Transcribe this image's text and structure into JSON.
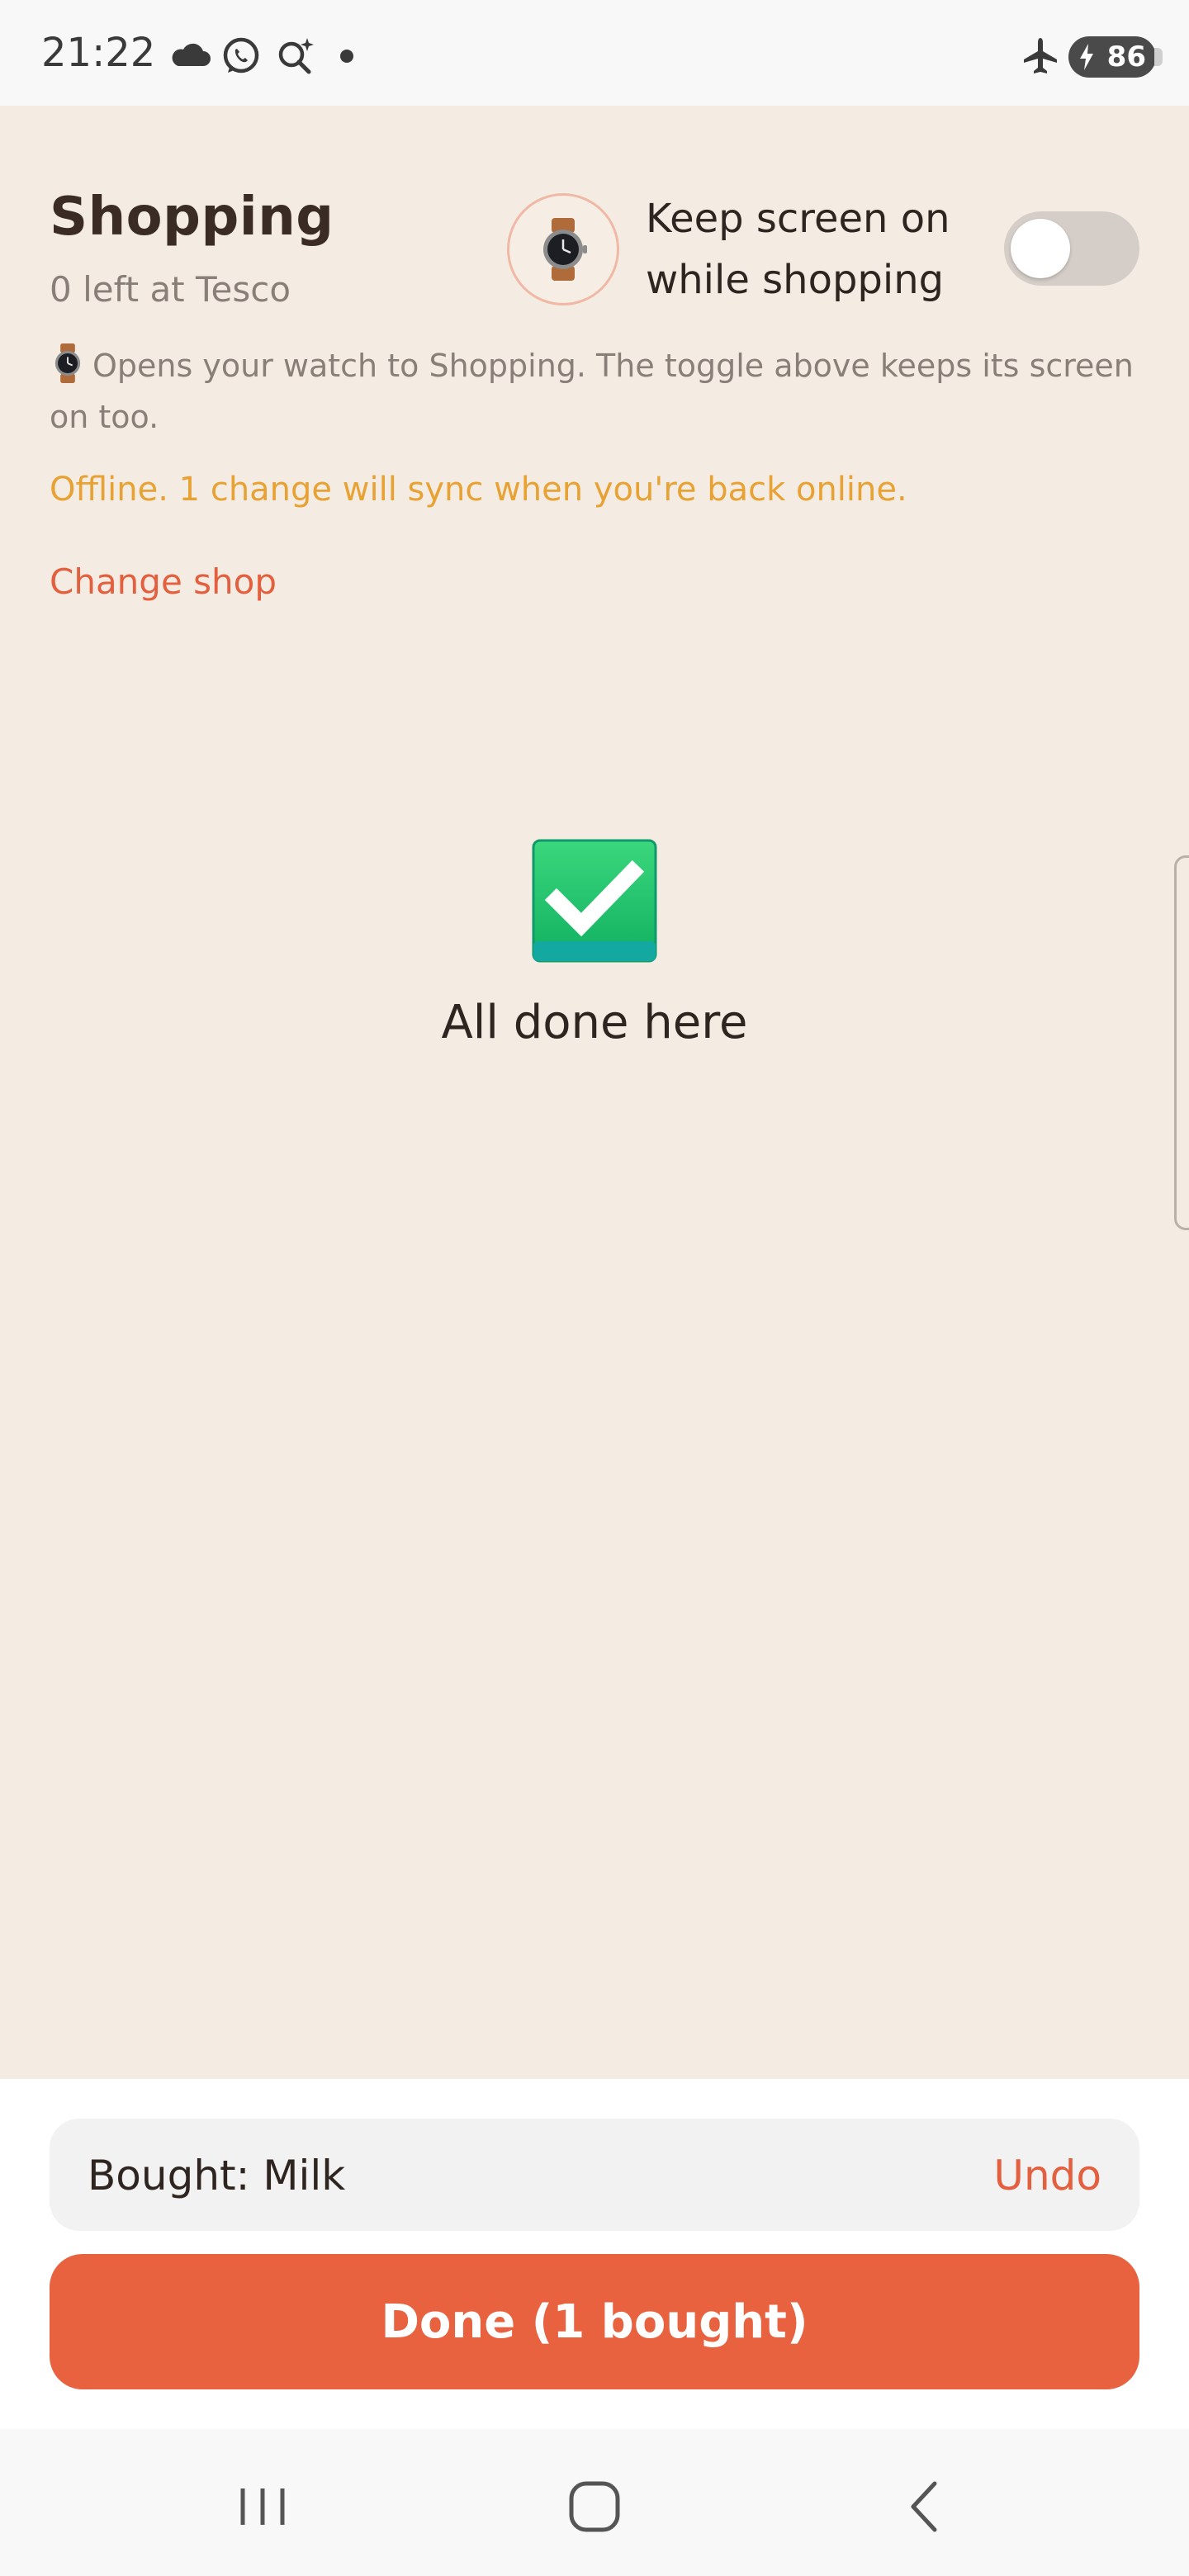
{
  "status_bar": {
    "time": "21:22",
    "icons": [
      "cloud-icon",
      "whatsapp-icon",
      "magic-search-icon",
      "dot-icon",
      "airplane-mode-icon",
      "battery-charging-icon"
    ],
    "battery_level": "86"
  },
  "header": {
    "title": "Shopping",
    "subtitle": "0 left at Tesco",
    "watch_icon": "watch-icon",
    "keep_screen_label": "Keep screen on while shopping",
    "keep_screen_on": false
  },
  "info_text": "Opens your watch to Shopping. The toggle above keeps its screen on too.",
  "offline_text": "Offline. 1 change will sync when you're back online.",
  "change_shop_label": "Change shop",
  "empty_state": {
    "icon": "check-mark-button-icon",
    "text": "All done here"
  },
  "snackbar": {
    "text": "Bought: Milk",
    "action": "Undo"
  },
  "done_button": "Done (1 bought)",
  "nav_bar": {
    "icons": [
      "recents-icon",
      "home-icon",
      "back-icon"
    ]
  },
  "colors": {
    "background": "#f4ece3",
    "accent": "#e8623f",
    "offline": "#e8a233",
    "success": "#20c46a"
  }
}
